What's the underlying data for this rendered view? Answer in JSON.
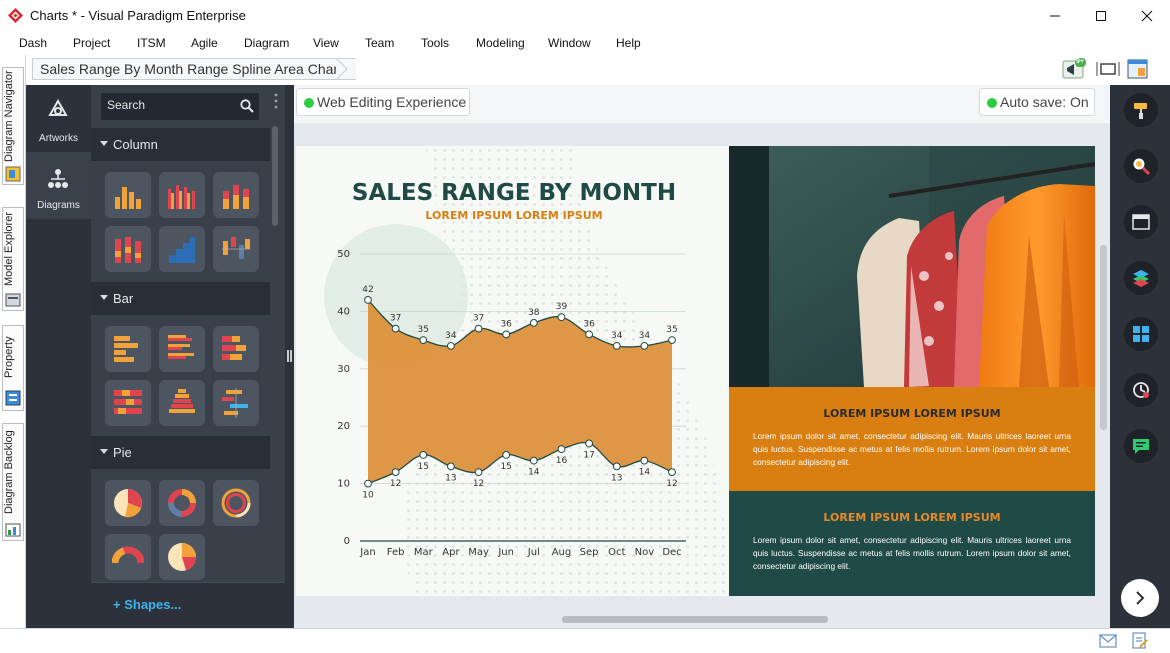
{
  "window": {
    "title": "Charts * - Visual Paradigm Enterprise",
    "controls": [
      "minimize",
      "maximize",
      "close"
    ]
  },
  "menu": [
    "Dash",
    "Project",
    "ITSM",
    "Agile",
    "Diagram",
    "View",
    "Team",
    "Tools",
    "Modeling",
    "Window",
    "Help"
  ],
  "breadcrumb": "Sales Range By Month Range Spline Area Chart",
  "toolbar": {
    "notification_badge": "9+"
  },
  "side_tabs": [
    "Diagram Navigator",
    "Model Explorer",
    "Property",
    "Diagram Backlog"
  ],
  "rail": {
    "items": [
      {
        "label": "Artworks",
        "icon": "artworks-icon",
        "active": false
      },
      {
        "label": "Diagrams",
        "icon": "diagrams-icon",
        "active": true
      }
    ]
  },
  "panel": {
    "search_placeholder": "Search",
    "categories": [
      {
        "label": "Column",
        "thumbs": [
          "column-chart",
          "grouped-column-chart",
          "stacked-column-chart",
          "stacked-column-chart-2",
          "step-column-chart",
          "column-range-chart"
        ]
      },
      {
        "label": "Bar",
        "thumbs": [
          "bar-chart",
          "grouped-bar-chart",
          "stacked-bar-chart",
          "stacked-bar-chart-2",
          "population-pyramid-chart",
          "bar-range-chart"
        ]
      },
      {
        "label": "Pie",
        "thumbs": [
          "pie-chart",
          "donut-chart",
          "ring-chart",
          "semi-donut-chart",
          "pie-chart-2"
        ]
      }
    ],
    "shapes_link": "Shapes..."
  },
  "canvas": {
    "web_editing": "Web Editing Experience",
    "auto_save": "Auto save: On"
  },
  "design": {
    "title": "SALES RANGE BY MONTH",
    "subtitle": "LOREM IPSUM LOREM IPSUM",
    "panels": [
      {
        "heading": "LOREM IPSUM LOREM IPSUM",
        "body": "Lorem ipsum dolor sit amet, consectetur adipiscing elit. Mauris ultrices laoreet urna quis luctus. Suspendisse ac metus at felis mollis rutrum. Lorem ipsum dolor sit amet, consectetur adipiscing elit.",
        "bg": "#d97f11",
        "heading_color": "#2a2a2a"
      },
      {
        "heading": "LOREM IPSUM LOREM IPSUM",
        "body": "Lorem ipsum dolor sit amet, consectetur adipiscing elit. Mauris ultrices laoreet urna quis luctus. Suspendisse ac metus at felis mollis rutrum. Lorem ipsum dolor sit amet, consectetur adipiscing elit.",
        "bg": "#1f4a45",
        "heading_color": "#e8892a"
      }
    ]
  },
  "chart_data": {
    "type": "area",
    "subtype": "spline range area",
    "title": "SALES RANGE BY MONTH",
    "subtitle": "LOREM IPSUM LOREM IPSUM",
    "categories": [
      "Jan",
      "Feb",
      "Mar",
      "Apr",
      "May",
      "Jun",
      "Jul",
      "Aug",
      "Sep",
      "Oct",
      "Nov",
      "Dec"
    ],
    "series": [
      {
        "values": [
          42,
          37,
          35,
          34,
          37,
          36,
          38,
          39,
          36,
          34,
          34,
          35
        ]
      },
      {
        "values": [
          10,
          12,
          15,
          13,
          12,
          15,
          14,
          16,
          17,
          13,
          14,
          12
        ]
      }
    ],
    "yticks": [
      0,
      10,
      20,
      30,
      40,
      50
    ],
    "ylim": [
      0,
      50
    ],
    "grid": true,
    "colors": {
      "fill": "#db8e36",
      "line": "#1f4a45",
      "title": "#1f4a45",
      "subtitle": "#d97f11"
    }
  }
}
